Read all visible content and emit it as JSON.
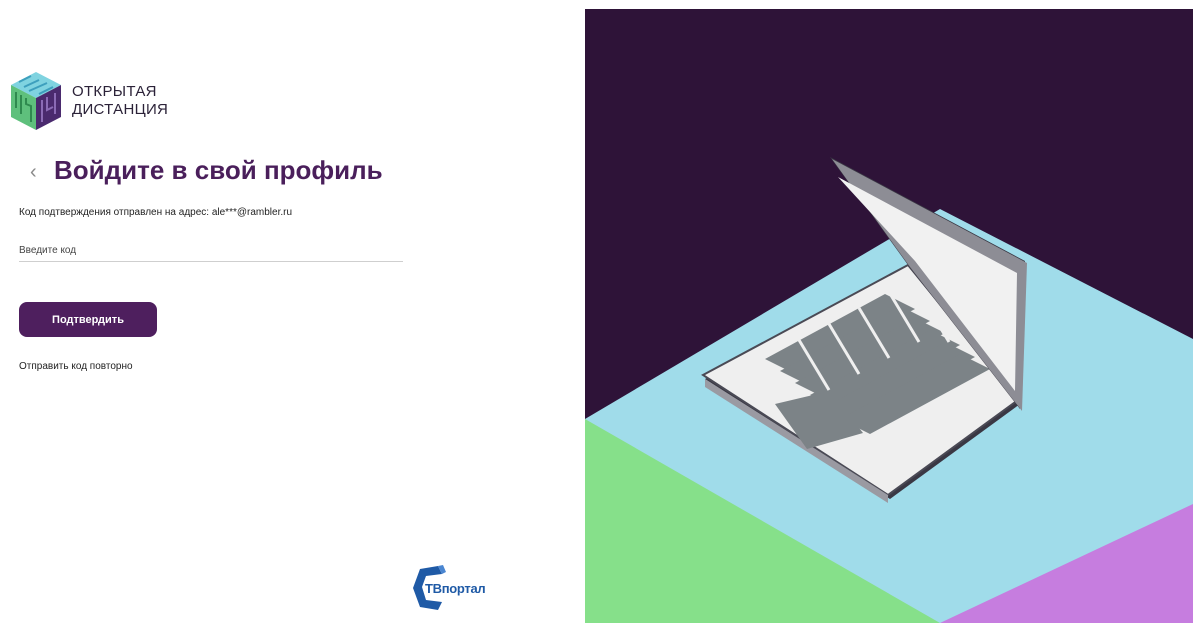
{
  "brand": {
    "line1": "ОТКРЫТАЯ",
    "line2": "ДИСТАНЦИЯ"
  },
  "form": {
    "back_icon": "chevron-left-icon",
    "title": "Войдите в свой профиль",
    "subtitle": "Код подтверждения отправлен на адрес: ale***@rambler.ru",
    "code_placeholder": "Введите код",
    "code_value": "",
    "confirm_label": "Подтвердить",
    "resend_label": "Отправить код повторно"
  },
  "footer_logo": {
    "part1": "ТВ",
    "part2": "портал"
  },
  "colors": {
    "accent": "#4e1f5e",
    "title": "#4a1f5b",
    "illustration_bg": "#2e1338",
    "floor_blue": "#a0dcea",
    "floor_green": "#86e08a",
    "floor_purple": "#c67ddf",
    "tv_logo_blue": "#1f5aa6"
  }
}
